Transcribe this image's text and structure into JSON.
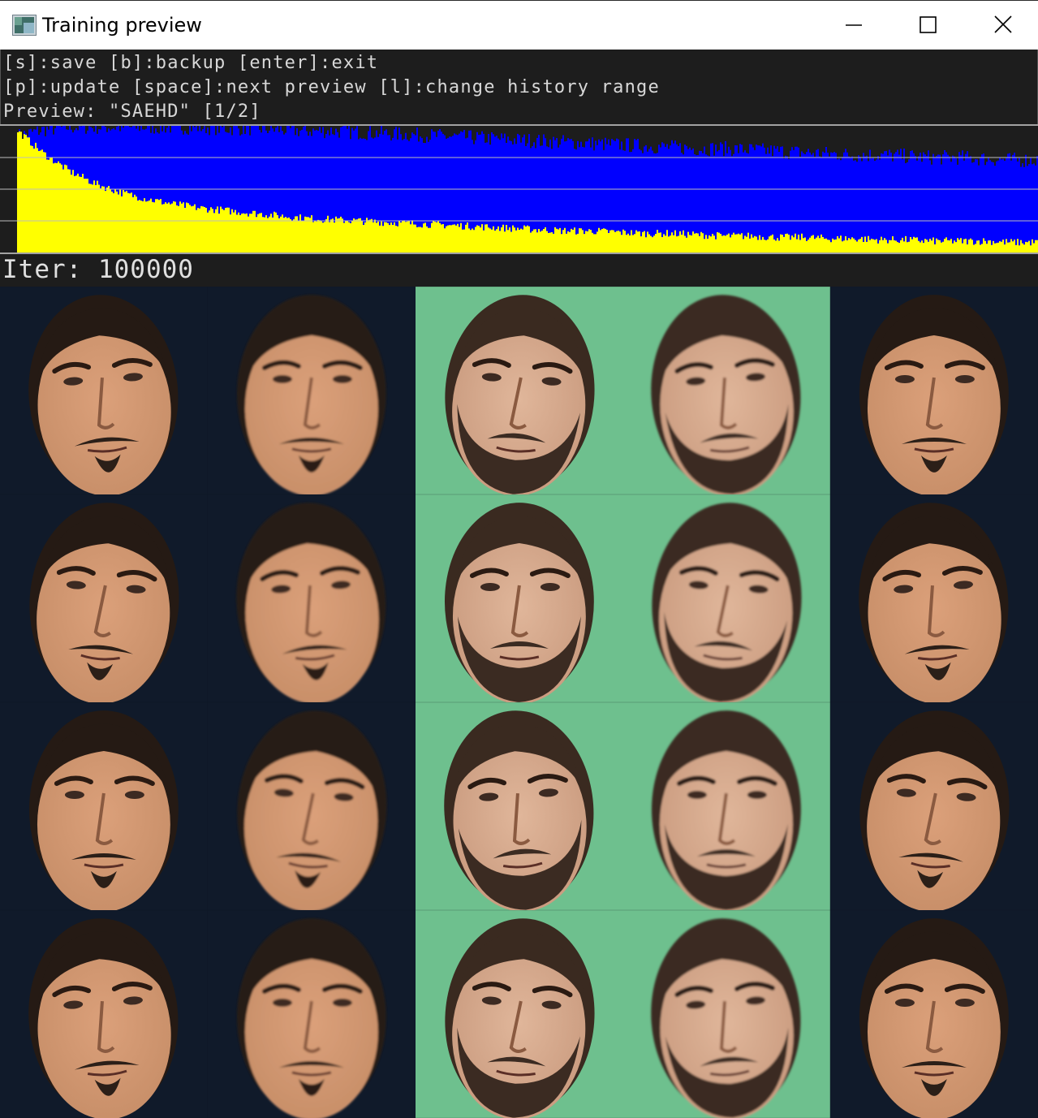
{
  "window": {
    "title": "Training preview",
    "icon": "app-window-icon",
    "controls": [
      "minimize-icon",
      "maximize-icon",
      "close-icon"
    ]
  },
  "console": {
    "line1": "[s]:save [b]:backup [enter]:exit",
    "line2": "[p]:update [space]:next preview [l]:change history range",
    "line3": "Preview: \"SAEHD\" [1/2]"
  },
  "chart_data": {
    "type": "area",
    "title": "",
    "series": [
      {
        "color": "#0000ff",
        "values": [
          0.92,
          0.97,
          0.99,
          0.99,
          0.99,
          0.99,
          0.99,
          0.99,
          0.98,
          0.98,
          0.97,
          0.96,
          0.96,
          0.95,
          0.94,
          0.93,
          0.92,
          0.91,
          0.9,
          0.89,
          0.88,
          0.87,
          0.86,
          0.85,
          0.84,
          0.83,
          0.82,
          0.82,
          0.81,
          0.8,
          0.79,
          0.78,
          0.77,
          0.77,
          0.76,
          0.75,
          0.75,
          0.74,
          0.73,
          0.73
        ]
      },
      {
        "color": "#ffff00",
        "values": [
          0.96,
          0.78,
          0.64,
          0.54,
          0.47,
          0.42,
          0.38,
          0.35,
          0.33,
          0.31,
          0.29,
          0.27,
          0.26,
          0.25,
          0.24,
          0.23,
          0.22,
          0.21,
          0.2,
          0.19,
          0.18,
          0.17,
          0.17,
          0.16,
          0.15,
          0.15,
          0.14,
          0.13,
          0.13,
          0.12,
          0.12,
          0.11,
          0.11,
          0.1,
          0.1,
          0.09,
          0.09,
          0.09,
          0.08,
          0.08
        ]
      }
    ],
    "ylim": [
      0,
      1
    ],
    "grid": true
  },
  "status": {
    "iteration_text": "Iter: 100000"
  },
  "preview": {
    "columns": 5,
    "rows": 4,
    "faces": [
      [
        "face-a",
        "face-a",
        "face-b",
        "face-b",
        "face-a"
      ],
      [
        "face-a",
        "face-a",
        "face-b",
        "face-b",
        "face-a"
      ],
      [
        "face-a",
        "face-a",
        "face-b",
        "face-b",
        "face-a"
      ],
      [
        "face-a",
        "face-a",
        "face-b",
        "face-b",
        "face-a"
      ]
    ],
    "backgrounds": {
      "face-a": "#101a2a",
      "face-b": "#6ec08e"
    }
  }
}
